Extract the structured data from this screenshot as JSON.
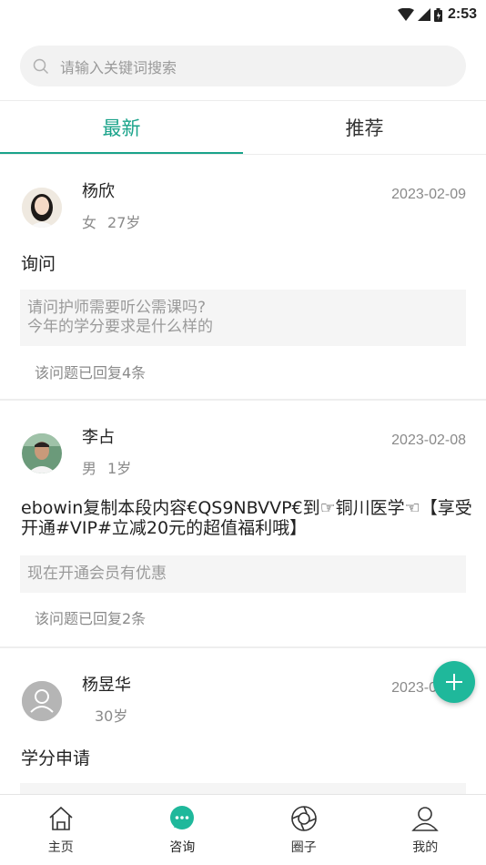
{
  "status_bar": {
    "time": "2:53"
  },
  "search": {
    "placeholder": "请输入关键词搜索"
  },
  "tabs": [
    {
      "label": "最新",
      "active": true
    },
    {
      "label": "推荐",
      "active": false
    }
  ],
  "posts": [
    {
      "name": "杨欣",
      "gender": "女",
      "age": "27岁",
      "date": "2023-02-09",
      "title": "询问",
      "quote": "请问护师需要听公需课吗?\n今年的学分要求是什么样的",
      "reply_info": "该问题已回复4条"
    },
    {
      "name": "李占",
      "gender": "男",
      "age": "1岁",
      "date": "2023-02-08",
      "title": "ebowin复制本段内容€QS9NBVVP€到☞铜川医学☜【享受\n开通#VIP#立减20元的超值福利哦】",
      "quote": "现在开通会员有优惠",
      "reply_info": "该问题已回复2条"
    },
    {
      "name": "杨昱华",
      "gender": "",
      "age": "30岁",
      "date": "2023-02-08",
      "title": "学分申请",
      "quote": "",
      "reply_info": ""
    }
  ],
  "bottom_nav": [
    {
      "label": "主页",
      "icon": "home-icon"
    },
    {
      "label": "咨询",
      "icon": "chat-icon",
      "active": true
    },
    {
      "label": "圈子",
      "icon": "circle-icon"
    },
    {
      "label": "我的",
      "icon": "profile-icon"
    }
  ],
  "colors": {
    "accent": "#1aa38a",
    "fab": "#1fb89b"
  }
}
